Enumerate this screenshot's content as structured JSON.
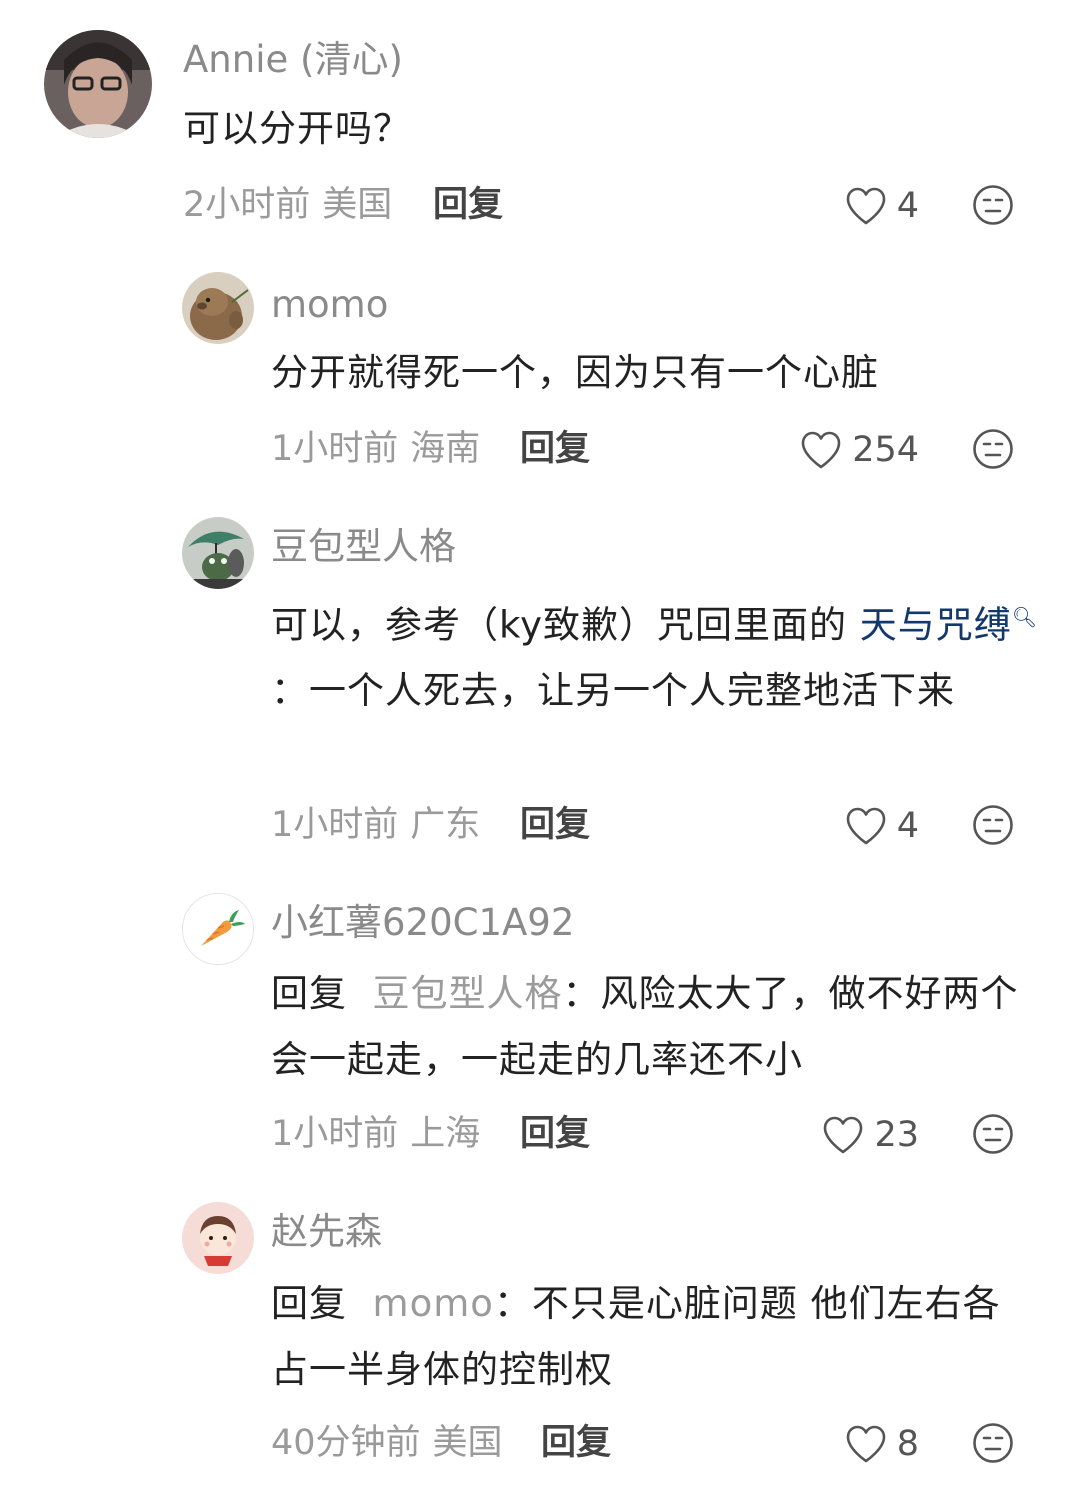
{
  "comments": [
    {
      "username": "Annie (清心)",
      "text": "可以分开吗？",
      "time": "2小时前",
      "location": "美国",
      "reply_label": "回复",
      "likes": "4"
    },
    {
      "username": "momo",
      "text": "分开就得死一个，因为只有一个心脏",
      "time": "1小时前",
      "location": "海南",
      "reply_label": "回复",
      "likes": "254"
    },
    {
      "username": "豆包型人格",
      "text_before": "可以，参考（ky致歉）咒回里面的 ",
      "link_text": "天与咒缚",
      "text_after": "：一个人死去，让另一个人完整地活下来",
      "time": "1小时前",
      "location": "广东",
      "reply_label": "回复",
      "likes": "4"
    },
    {
      "username": "小红薯620C1A92",
      "reply_prefix": "回复",
      "mention": "豆包型人格",
      "text": "：风险太大了，做不好两个会一起走，一起走的几率还不小",
      "time": "1小时前",
      "location": "上海",
      "reply_label": "回复",
      "likes": "23"
    },
    {
      "username": "赵先森",
      "reply_prefix": "回复",
      "mention": "momo",
      "text": "：不只是心脏问题 他们左右各占一半身体的控制权",
      "time": "40分钟前",
      "location": "美国",
      "reply_label": "回复",
      "likes": "8"
    }
  ],
  "colors": {
    "username": "#8a8a8a",
    "meta": "#9a9a9a",
    "link": "#13386c",
    "mention": "#9b9b9b"
  },
  "icons": {
    "like": "heart-outline-icon",
    "dislike": "neutral-face-icon",
    "search": "search-magnifier-icon",
    "carrot": "carrot-icon"
  }
}
